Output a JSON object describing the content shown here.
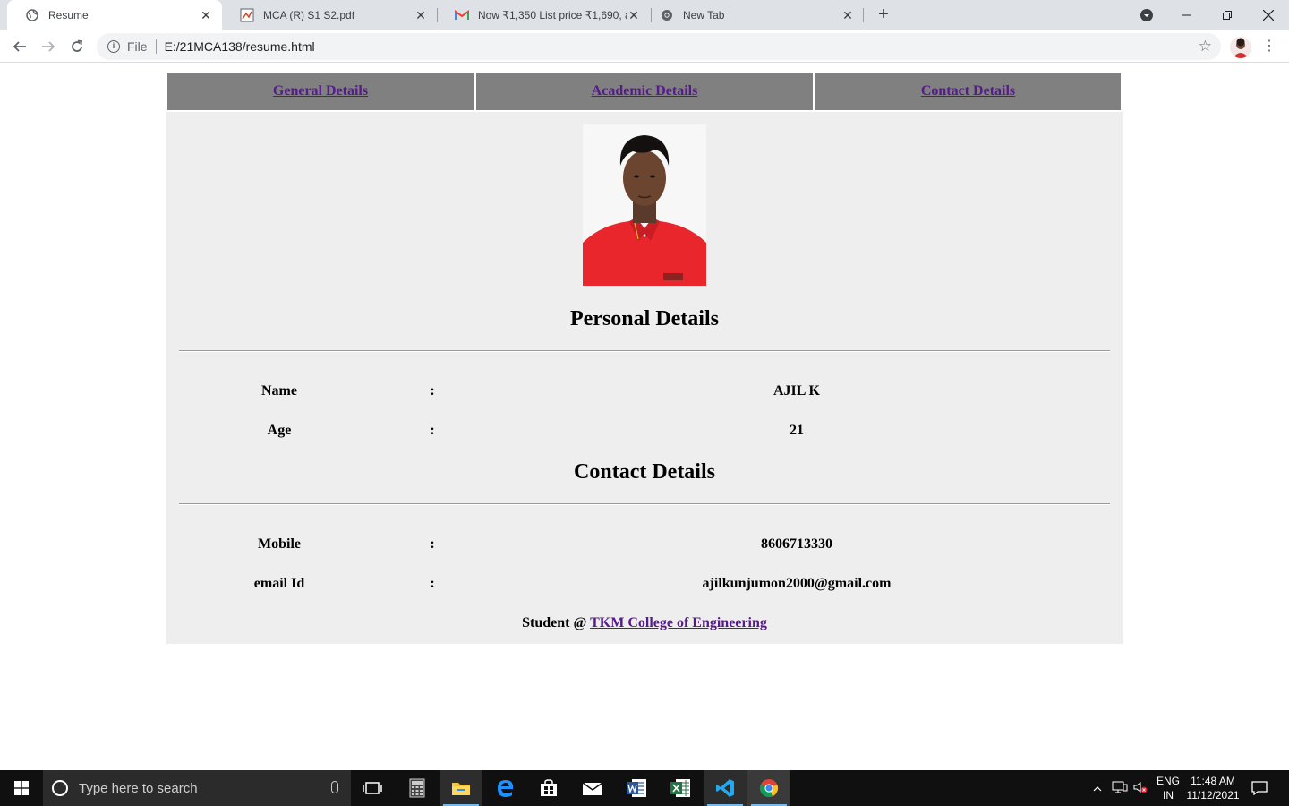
{
  "browser": {
    "tabs": [
      {
        "title": "Resume",
        "icon": "globe-icon",
        "active": true
      },
      {
        "title": "MCA (R) S1 S2.pdf",
        "icon": "pdf-icon",
        "active": false
      },
      {
        "title": "Now ₹1,350 List price ₹1,690, and",
        "icon": "gmail-icon",
        "active": false
      },
      {
        "title": "New Tab",
        "icon": "chrome-icon",
        "active": false
      }
    ],
    "address": {
      "scheme": "File",
      "url": "E:/21MCA138/resume.html"
    }
  },
  "page": {
    "nav": [
      {
        "label": "General Details"
      },
      {
        "label": "Academic Details"
      },
      {
        "label": "Contact Details"
      }
    ],
    "personal_title": "Personal Details",
    "personal": [
      {
        "label": "Name",
        "sep": ":",
        "value": "AJIL K"
      },
      {
        "label": "Age",
        "sep": ":",
        "value": "21"
      }
    ],
    "contact_title": "Contact Details",
    "contact": [
      {
        "label": "Mobile",
        "sep": ":",
        "value": "8606713330"
      },
      {
        "label": "email Id",
        "sep": ":",
        "value": "ajilkunjumon2000@gmail.com"
      }
    ],
    "footer": {
      "prefix": "Student @ ",
      "link": "TKM College of Engineering"
    }
  },
  "taskbar": {
    "search_placeholder": "Type here to search",
    "lang_top": "ENG",
    "lang_bottom": "IN",
    "time": "11:48 AM",
    "date": "11/12/2021"
  },
  "colors": {
    "nav_bg": "#808080",
    "card_bg": "#eeeeee",
    "link": "#551a8b",
    "shirt": "#e8262b"
  }
}
